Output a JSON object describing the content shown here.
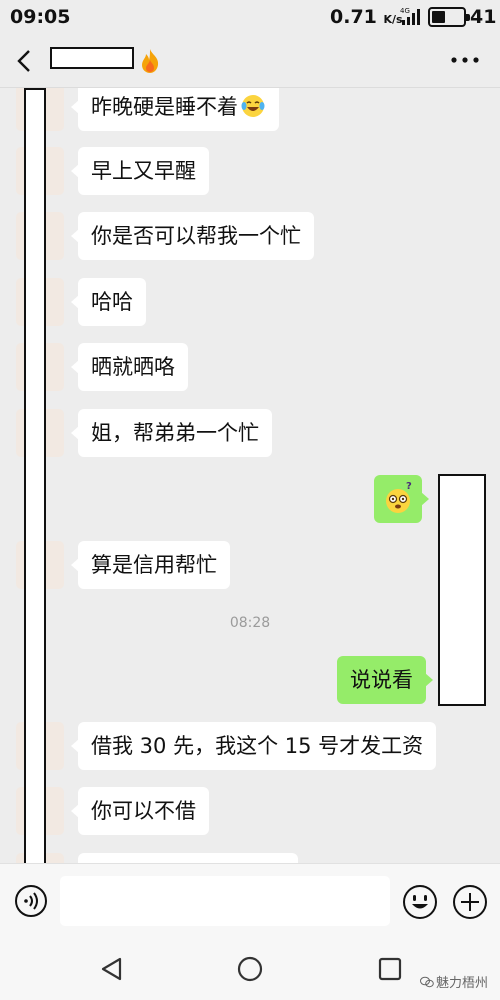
{
  "status_bar": {
    "time": "09:05",
    "net_speed": "0.71",
    "net_speed_unit": "K/s",
    "network_type": "4G",
    "battery_level": "41"
  },
  "header": {
    "back_icon": "chevron-left-icon",
    "title_badge_icon": "fire-emoji-icon",
    "more_icon": "ellipsis-icon"
  },
  "messages": [
    {
      "side": "in",
      "text": "昨晚硬是睡不着",
      "emoji": "tears-of-joy-emoji-icon"
    },
    {
      "side": "in",
      "text": "早上又早醒"
    },
    {
      "side": "in",
      "text": "你是否可以帮我一个忙"
    },
    {
      "side": "in",
      "text": "哈哈"
    },
    {
      "side": "in",
      "text": "晒就晒咯"
    },
    {
      "side": "in",
      "text": "姐，帮弟弟一个忙"
    },
    {
      "side": "out",
      "emoji": "dizzy-face-emoji-icon"
    },
    {
      "side": "in",
      "text": "算是信用帮忙"
    },
    {
      "timestamp": "08:28"
    },
    {
      "side": "out",
      "text": "说说看"
    },
    {
      "side": "in",
      "text": "借我 30 先，我这个 15 号才发工资"
    },
    {
      "side": "in",
      "text": "你可以不借"
    }
  ],
  "input_bar": {
    "voice_icon": "voice-input-icon",
    "emoji_icon": "emoji-smile-icon",
    "plus_icon": "plus-circle-icon"
  },
  "nav_bar": {
    "back_icon": "triangle-back-icon",
    "home_icon": "circle-home-icon",
    "recents_icon": "square-recents-icon"
  },
  "watermark": {
    "text": "魅力梧州"
  },
  "colors": {
    "background": "#ededed",
    "incoming_bubble": "#ffffff",
    "outgoing_bubble": "#95ec69"
  }
}
